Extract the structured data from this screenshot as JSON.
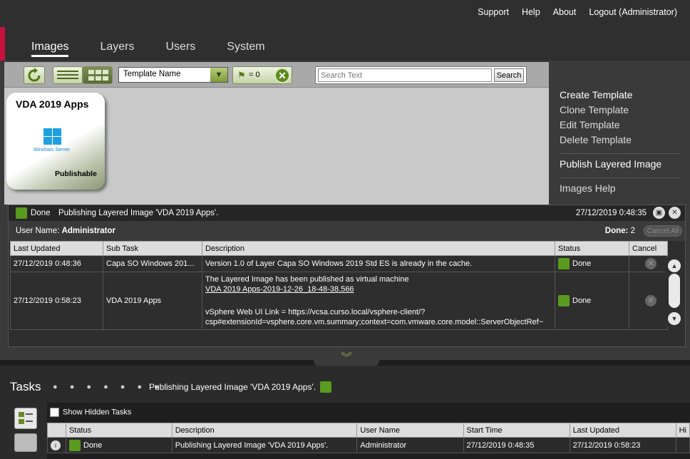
{
  "top_links": [
    "Support",
    "Help",
    "About",
    "Logout (Administrator)"
  ],
  "nav_tabs": [
    "Images",
    "Layers",
    "Users",
    "System"
  ],
  "toolbar": {
    "sort_selected": "Template Name",
    "flag_count": "= 0",
    "search_placeholder": "Search Text",
    "search_button": "Search"
  },
  "tile": {
    "name": "VDA 2019 Apps",
    "os_label": "Windows Server",
    "status": "Publishable"
  },
  "side_menu": {
    "create": "Create Template",
    "clone": "Clone Template",
    "edit": "Edit Template",
    "delete": "Delete Template",
    "publish": "Publish Layered Image",
    "help": "Images Help"
  },
  "task_detail": {
    "status": "Done",
    "message": "Publishing Layered Image 'VDA 2019 Apps'.",
    "time": "27/12/2019 0:48:35",
    "user_label": "User Name:",
    "user_name": "Administrator",
    "done_label": "Done:",
    "done_count": "2",
    "cancel_all": "Cancel All",
    "columns": [
      "Last Updated",
      "Sub Task",
      "Description",
      "Status",
      "Cancel"
    ],
    "rows": [
      {
        "last_updated": "27/12/2019 0:48:36",
        "sub_task": "Capa SO Windows 201...",
        "description": "Version 1.0 of Layer Capa SO Windows 2019 Std ES is already in the cache.",
        "status": "Done"
      },
      {
        "last_updated": "27/12/2019 0:58:23",
        "sub_task": "VDA 2019 Apps",
        "description_line1": "The Layered Image has been published as virtual machine",
        "description_link": "VDA 2019 Apps-2019-12-26_18-48-38.566",
        "description_line3": "vSphere Web UI Link = https://vcsa.curso.local/vsphere-client/?",
        "description_line4": "csp#extensionId=vsphere.core.vm.summary;context=com.vmware.core.model::ServerObjectRef~",
        "status": "Done"
      }
    ]
  },
  "tasks_bar": {
    "title": "Tasks",
    "dots": "● ● ● ● ● ● ●",
    "message": "Publishing Layered Image 'VDA 2019 Apps'.",
    "show_hidden": "Show Hidden Tasks",
    "columns": [
      "Status",
      "Description",
      "User Name",
      "Start Time",
      "Last Updated",
      "Hi"
    ],
    "rows": [
      {
        "status": "Done",
        "description": "Publishing Layered Image 'VDA 2019 Apps'.",
        "user": "Administrator",
        "start": "27/12/2019 0:48:35",
        "updated": "27/12/2019 0:58:23"
      }
    ]
  },
  "colors": {
    "accent_red": "#c8103e",
    "done_green": "#5a9a1e"
  }
}
